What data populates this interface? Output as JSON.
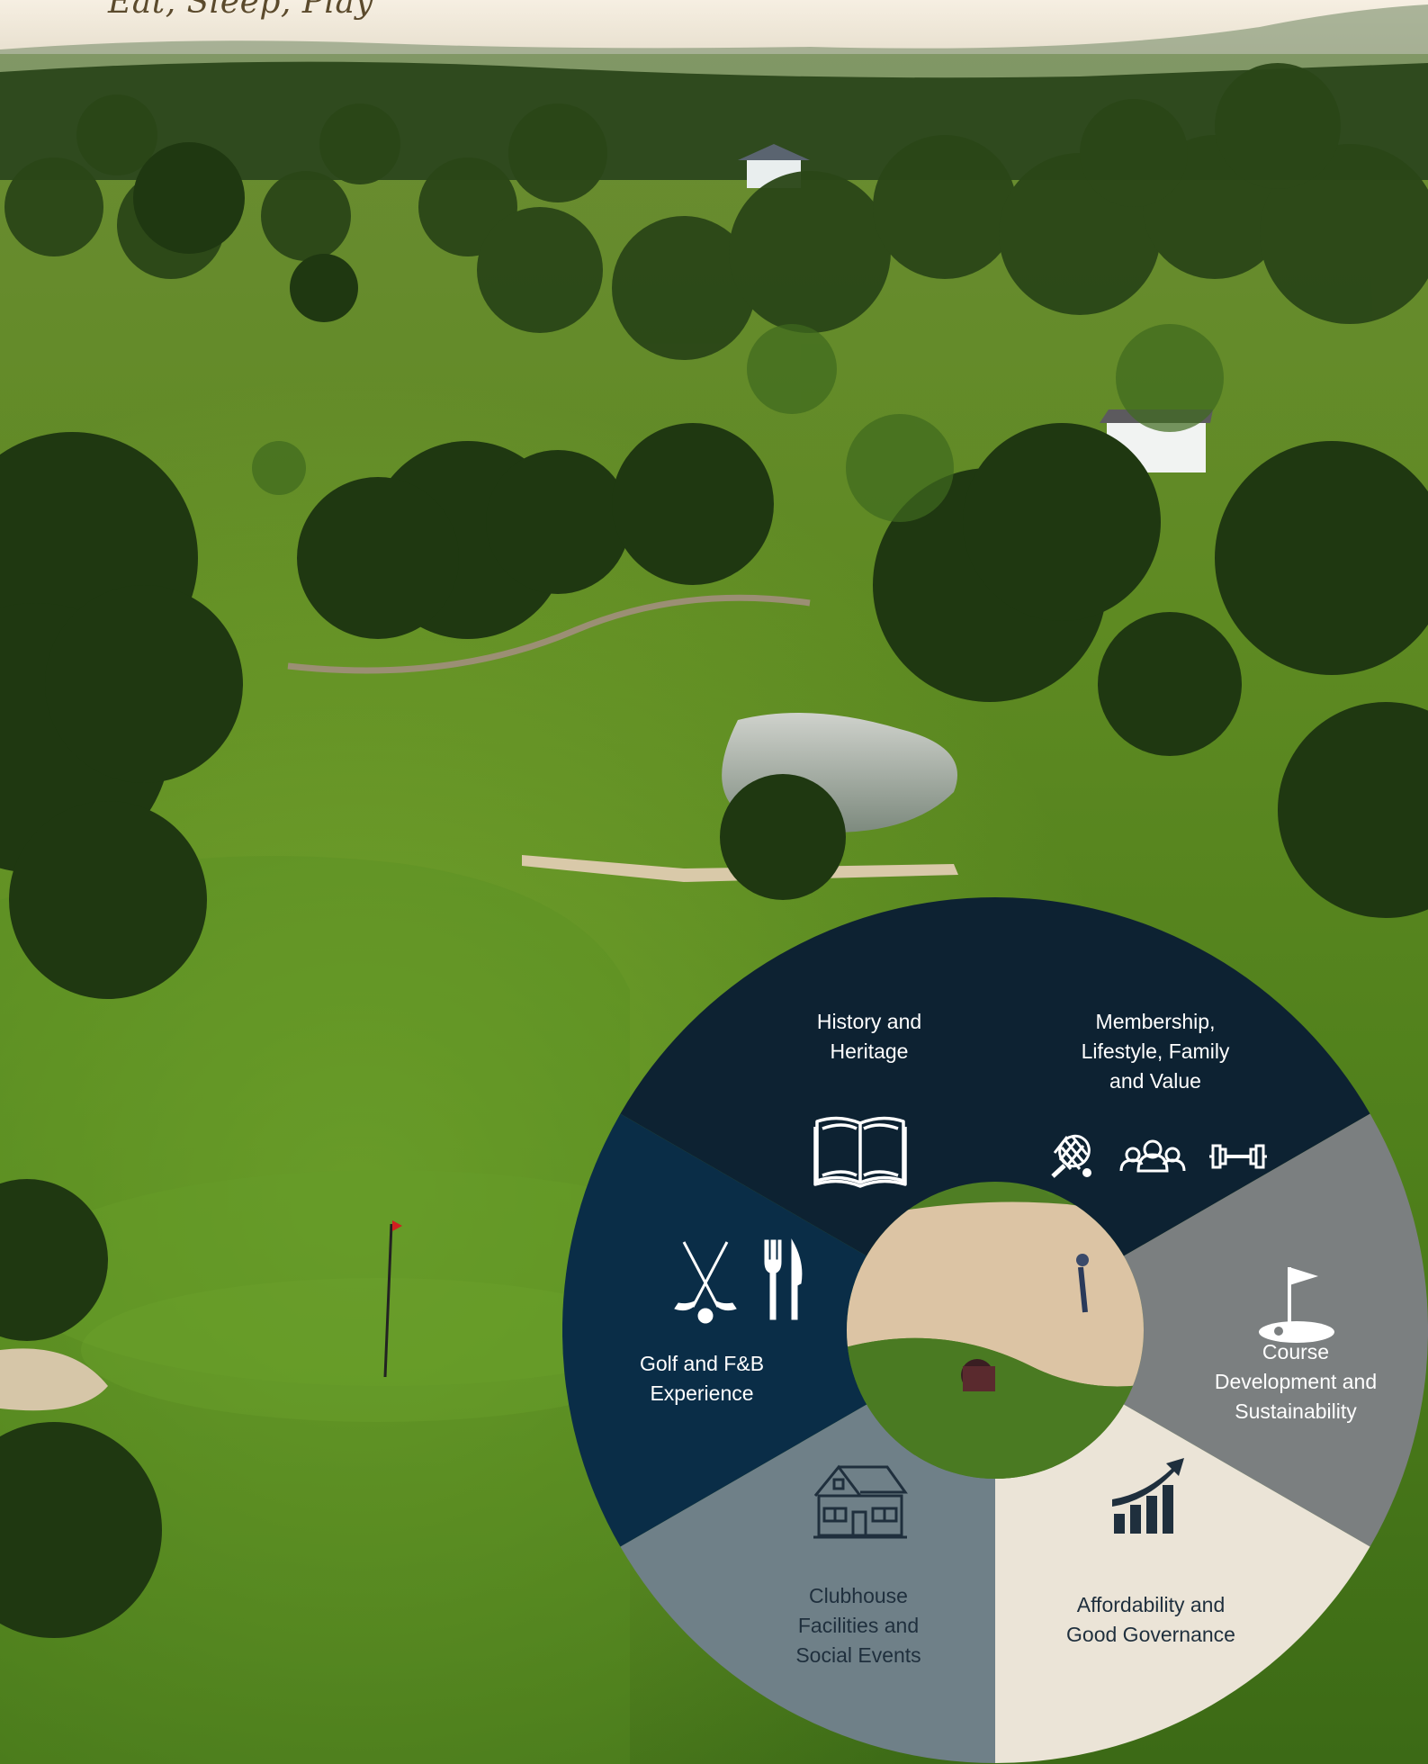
{
  "tagline": "Eat, Sleep, Play",
  "colors": {
    "navy_dark": "#0d2232",
    "navy": "#0a2d47",
    "gray": "#7b7f80",
    "slate": "#6f8088",
    "cream": "#ebe4d7",
    "icon_light": "#ffffff",
    "icon_dark": "#1f2f3d"
  },
  "segments": {
    "history": {
      "label": [
        "History and",
        "Heritage"
      ],
      "icon": "book-icon"
    },
    "membership": {
      "label": [
        "Membership,",
        "Lifestyle, Family",
        "and Value"
      ],
      "icons": [
        "tennis-racket-icon",
        "people-group-icon",
        "dumbbell-icon"
      ]
    },
    "course": {
      "label": [
        "Course",
        "Development and",
        "Sustainability"
      ],
      "icon": "golf-flag-icon"
    },
    "affordability": {
      "label": [
        "Affordability and",
        "Good Governance"
      ],
      "icon": "growth-chart-icon"
    },
    "clubhouse": {
      "label": [
        "Clubhouse",
        "Facilities and",
        "Social Events"
      ],
      "icon": "house-icon"
    },
    "golf_fb": {
      "label": [
        "Golf and F&B",
        "Experience"
      ],
      "icons": [
        "golf-clubs-icon",
        "fork-knife-icon"
      ]
    }
  }
}
